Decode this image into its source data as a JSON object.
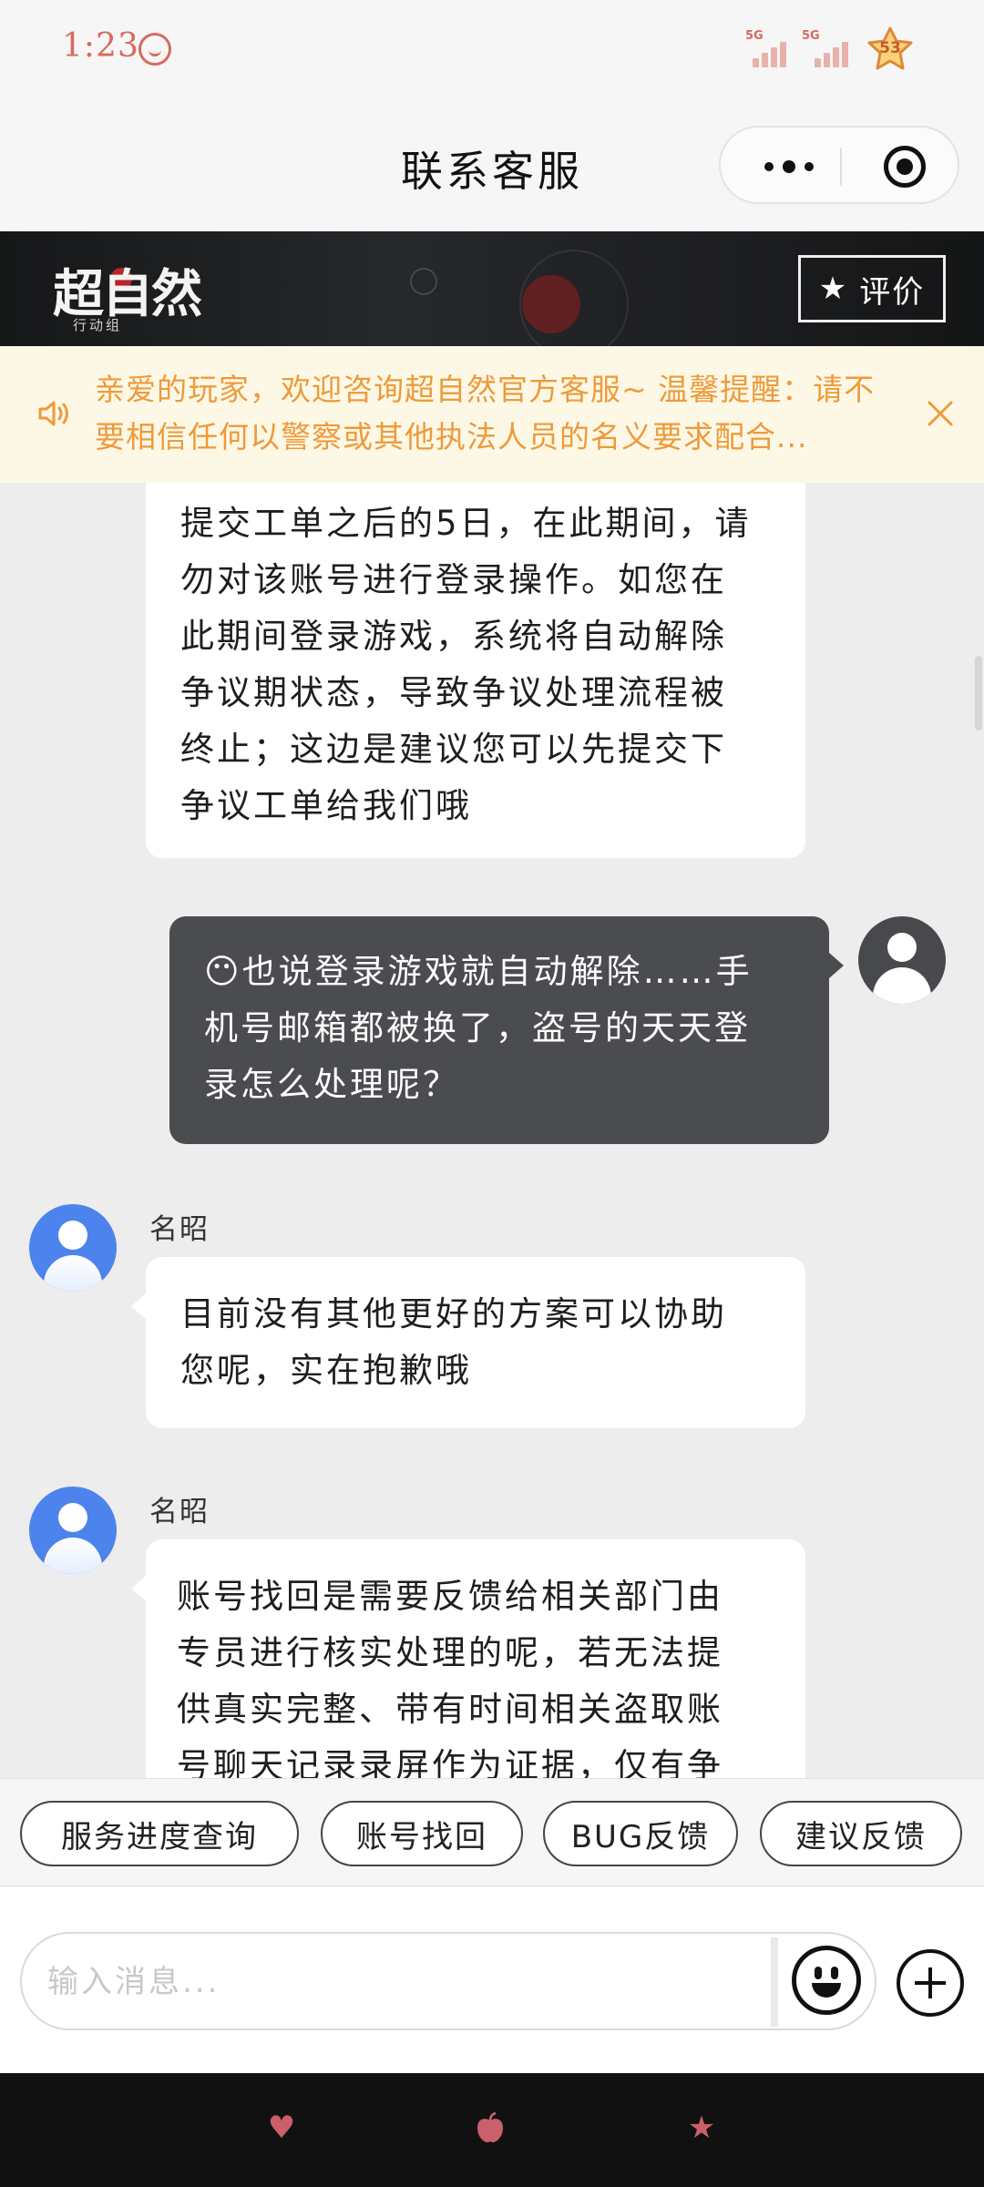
{
  "status_bar": {
    "time": "1:23",
    "battery_level": "53",
    "signal_tags": [
      "5G",
      "5G"
    ]
  },
  "header": {
    "title": "联系客服"
  },
  "banner": {
    "logo": "超自然",
    "logo_sub": "行动组",
    "rate_label": "评价"
  },
  "notice": {
    "text": "亲爱的玩家，欢迎咨询超自然官方客服~ 温馨提醒：请不要相信任何以警察或其他执法人员的名义要求配合..."
  },
  "messages": [
    {
      "from": "agent",
      "lines": [
        "提交工单之后的5日，在此期间，请",
        "勿对该账号进行登录操作。如您在",
        "此期间登录游戏，系统将自动解除",
        "争议期状态，导致争议处理流程被",
        "终止；这边是建议您可以先提交下",
        "争议工单给我们哦"
      ]
    },
    {
      "from": "user",
      "lines": [
        "😶也说登录游戏就自动解除……手",
        "机号邮箱都被换了，盗号的天天登",
        "录怎么处理呢？"
      ]
    },
    {
      "from": "agent",
      "sender": "名昭",
      "lines": [
        "目前没有其他更好的方案可以协助",
        "您呢，实在抱歉哦"
      ]
    },
    {
      "from": "agent",
      "sender": "名昭",
      "lines": [
        "账号找回是需要反馈给相关部门由",
        "专员进行核实处理的呢，若无法提",
        "供真实完整、带有时间相关盗取账",
        "号聊天记录录屏作为证据，仅有争"
      ]
    }
  ],
  "quick_replies": [
    "服务进度查询",
    "账号找回",
    "BUG反馈",
    "建议反馈"
  ],
  "input": {
    "placeholder": "输入消息..."
  },
  "bottom_nav": {
    "icons": [
      "heart-icon",
      "apple-icon",
      "star-icon"
    ]
  },
  "colors": {
    "notice_text": "#ee9a3a",
    "notice_bg": "#fdf8e6",
    "agent_avatar": "#4d83ec",
    "user_bubble": "#4b4c50",
    "status_accent": "#d9695f"
  }
}
